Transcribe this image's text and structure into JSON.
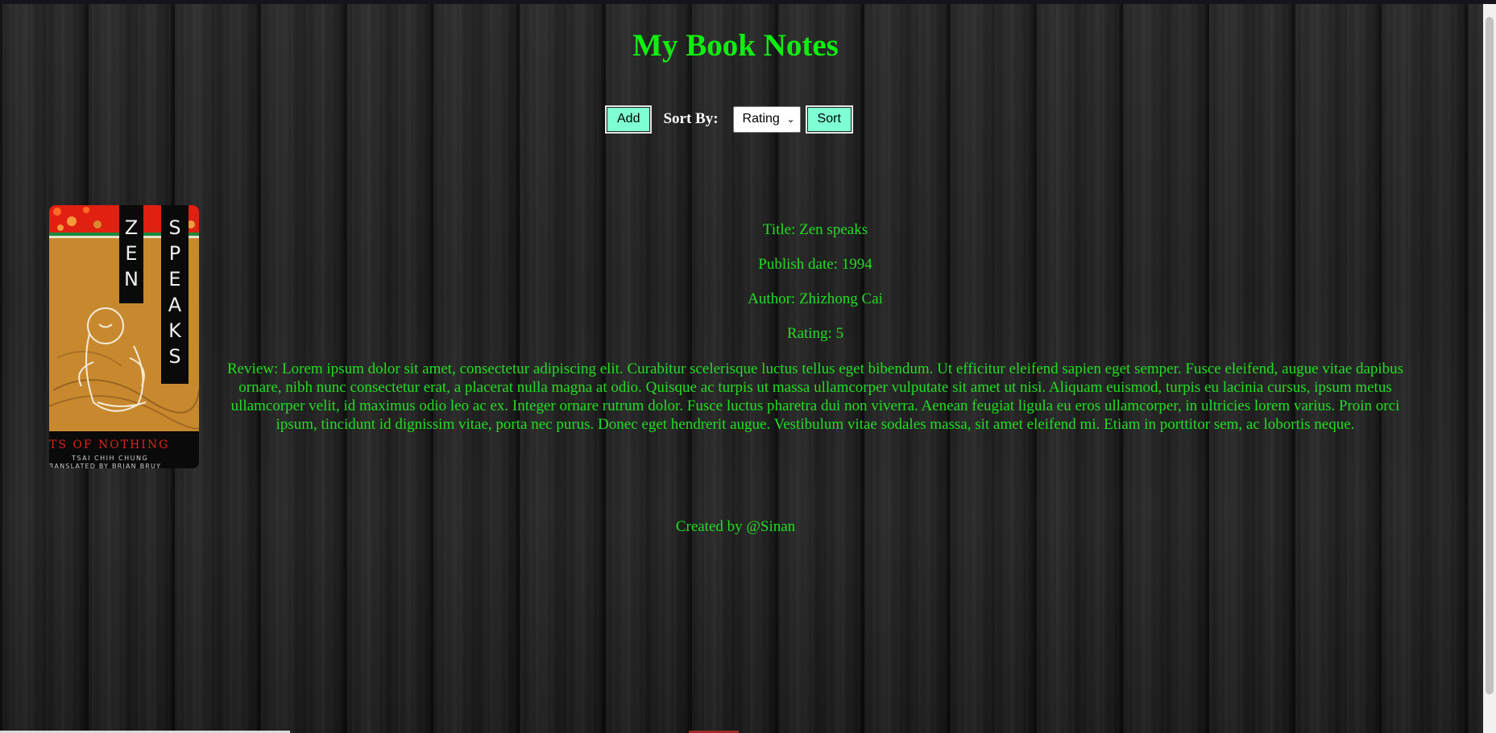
{
  "page": {
    "title": "My Book Notes"
  },
  "controls": {
    "add_label": "Add",
    "sort_by_label": "Sort By:",
    "sort_selected": "Rating",
    "sort_button_label": "Sort"
  },
  "book": {
    "cover": {
      "title_words": [
        "ZEN",
        "SPEAKS"
      ],
      "subtitle": "TS OF NOTHING",
      "credit_line1": "TSAI CHIH CHUNG",
      "credit_line2": "RANSLATED BY BRIAN BRUY"
    },
    "title_line": "Title: Zen speaks",
    "publish_line": "Publish date: 1994",
    "author_line": "Author: Zhizhong Cai",
    "rating_line": "Rating: 5",
    "review_line": "Review: Lorem ipsum dolor sit amet, consectetur adipiscing elit. Curabitur scelerisque luctus tellus eget bibendum. Ut efficitur eleifend sapien eget semper. Fusce eleifend, augue vitae dapibus ornare, nibh nunc consectetur erat, a placerat nulla magna at odio. Quisque ac turpis ut massa ullamcorper vulputate sit amet ut nisi. Aliquam euismod, turpis eu lacinia cursus, ipsum metus ullamcorper velit, id maximus odio leo ac ex. Integer ornare rutrum dolor. Fusce luctus pharetra dui non viverra. Aenean feugiat ligula eu eros ullamcorper, in ultricies lorem varius. Proin orci ipsum, tincidunt id dignissim vitae, porta nec purus. Donec eget hendrerit augue. Vestibulum vitae sodales massa, sit amet eleifend mi. Etiam in porttitor sem, ac lobortis neque."
  },
  "footer": {
    "credit": "Created by @Sinan"
  },
  "colors": {
    "heading": "#10ee10",
    "text": "#22dd22",
    "button_bg": "#7fffd4",
    "cover_orange": "#c8892e",
    "cover_red": "#e02010"
  }
}
